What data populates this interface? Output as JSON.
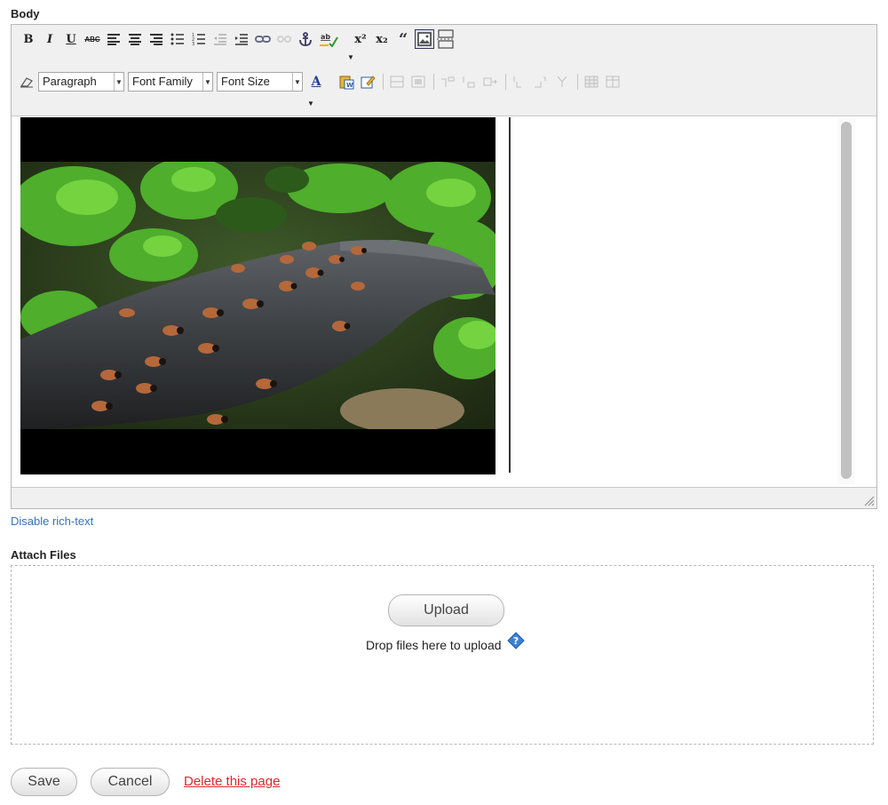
{
  "body_field": {
    "label": "Body"
  },
  "toolbar": {
    "row1_buttons": [
      {
        "name": "bold-button",
        "glyph": "B"
      },
      {
        "name": "italic-button",
        "glyph": "I"
      },
      {
        "name": "underline-button",
        "glyph": "U"
      },
      {
        "name": "strikethrough-button",
        "glyph": "ABC"
      }
    ],
    "format_select": "Paragraph",
    "font_family_select": "Font Family",
    "font_size_select": "Font Size",
    "font_color_glyph": "A",
    "superscript_glyph": "x²",
    "subscript_glyph": "x₂",
    "blockquote_glyph": "“"
  },
  "editor": {
    "disable_rich_text": "Disable rich-text"
  },
  "attach": {
    "label": "Attach Files",
    "upload_label": "Upload",
    "drop_text": "Drop files here to upload",
    "help_glyph": "?"
  },
  "actions": {
    "save_label": "Save",
    "cancel_label": "Cancel",
    "delete_label": "Delete this page"
  },
  "colors": {
    "link": "#3374b8",
    "delete": "#e0262f",
    "help_icon": "#3b82d6"
  }
}
